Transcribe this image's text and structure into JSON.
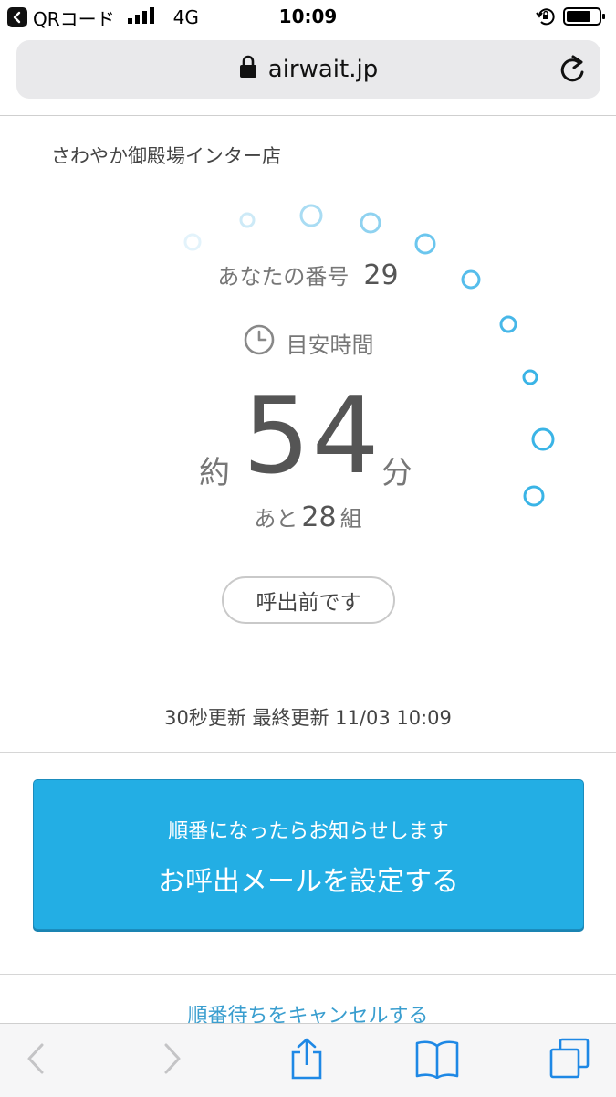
{
  "status_bar": {
    "back_app": "QRコード",
    "network": "4G",
    "time": "10:09"
  },
  "url_bar": {
    "domain": "airwait.jp"
  },
  "store": {
    "name": "さわやか御殿場インター店"
  },
  "ticket": {
    "your_number_label": "あなたの番号",
    "your_number": "29",
    "eta_label": "目安時間",
    "wait_prefix": "約",
    "wait_value": "54",
    "wait_unit": "分",
    "groups_prefix": "あと",
    "groups_value": "28",
    "groups_unit": "組",
    "status": "呼出前です"
  },
  "update_info": "30秒更新 最終更新 11/03 10:09",
  "mail_button": {
    "subtitle": "順番になったらお知らせします",
    "label": "お呼出メールを設定する"
  },
  "cancel_link": "順番待ちをキャンセルする",
  "colors": {
    "primary": "#23aee4",
    "spinner": "#3ab4e6",
    "link": "#3a9ecf",
    "toolbar_icon": "#1e88e5"
  }
}
